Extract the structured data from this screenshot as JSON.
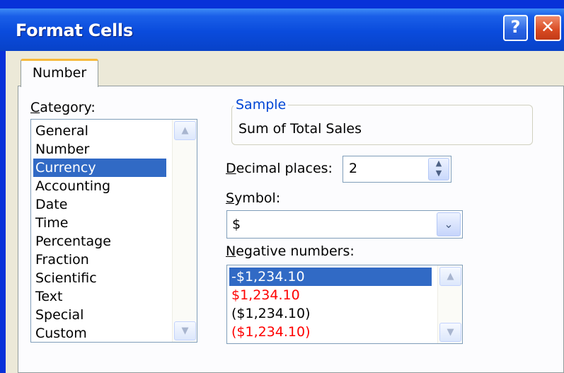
{
  "window": {
    "title": "Format Cells",
    "help_label": "?",
    "close_label": "✕"
  },
  "tabs": [
    {
      "label": "Number",
      "active": true
    }
  ],
  "category": {
    "label_hotkey": "C",
    "label_rest": "ategory:",
    "items": [
      "General",
      "Number",
      "Currency",
      "Accounting",
      "Date",
      "Time",
      "Percentage",
      "Fraction",
      "Scientific",
      "Text",
      "Special",
      "Custom"
    ],
    "selected": "Currency"
  },
  "sample": {
    "title": "Sample",
    "value": "Sum of Total Sales"
  },
  "decimal_places": {
    "label_hotkey": "D",
    "label_rest": "ecimal places:",
    "value": "2"
  },
  "symbol": {
    "label_hotkey": "S",
    "label_rest": "ymbol:",
    "value": "$"
  },
  "negative_numbers": {
    "label_hotkey": "N",
    "label_rest": "egative numbers:",
    "items": [
      {
        "text": "-$1,234.10",
        "color": "#000000"
      },
      {
        "text": "$1,234.10",
        "color": "#ff0000"
      },
      {
        "text": "($1,234.10)",
        "color": "#000000"
      },
      {
        "text": "($1,234.10)",
        "color": "#ff0000"
      }
    ],
    "selected_index": 0
  },
  "colors": {
    "titlebar": "#0a4bdc",
    "selection": "#316ac5",
    "dialog_bg": "#ece9d8",
    "tab_highlight": "#f7b93b"
  },
  "icons": {
    "scroll_up": "scroll-up-icon",
    "scroll_down": "scroll-down-icon",
    "spin": "spin-arrows-icon",
    "dropdown": "chevron-down-icon"
  }
}
